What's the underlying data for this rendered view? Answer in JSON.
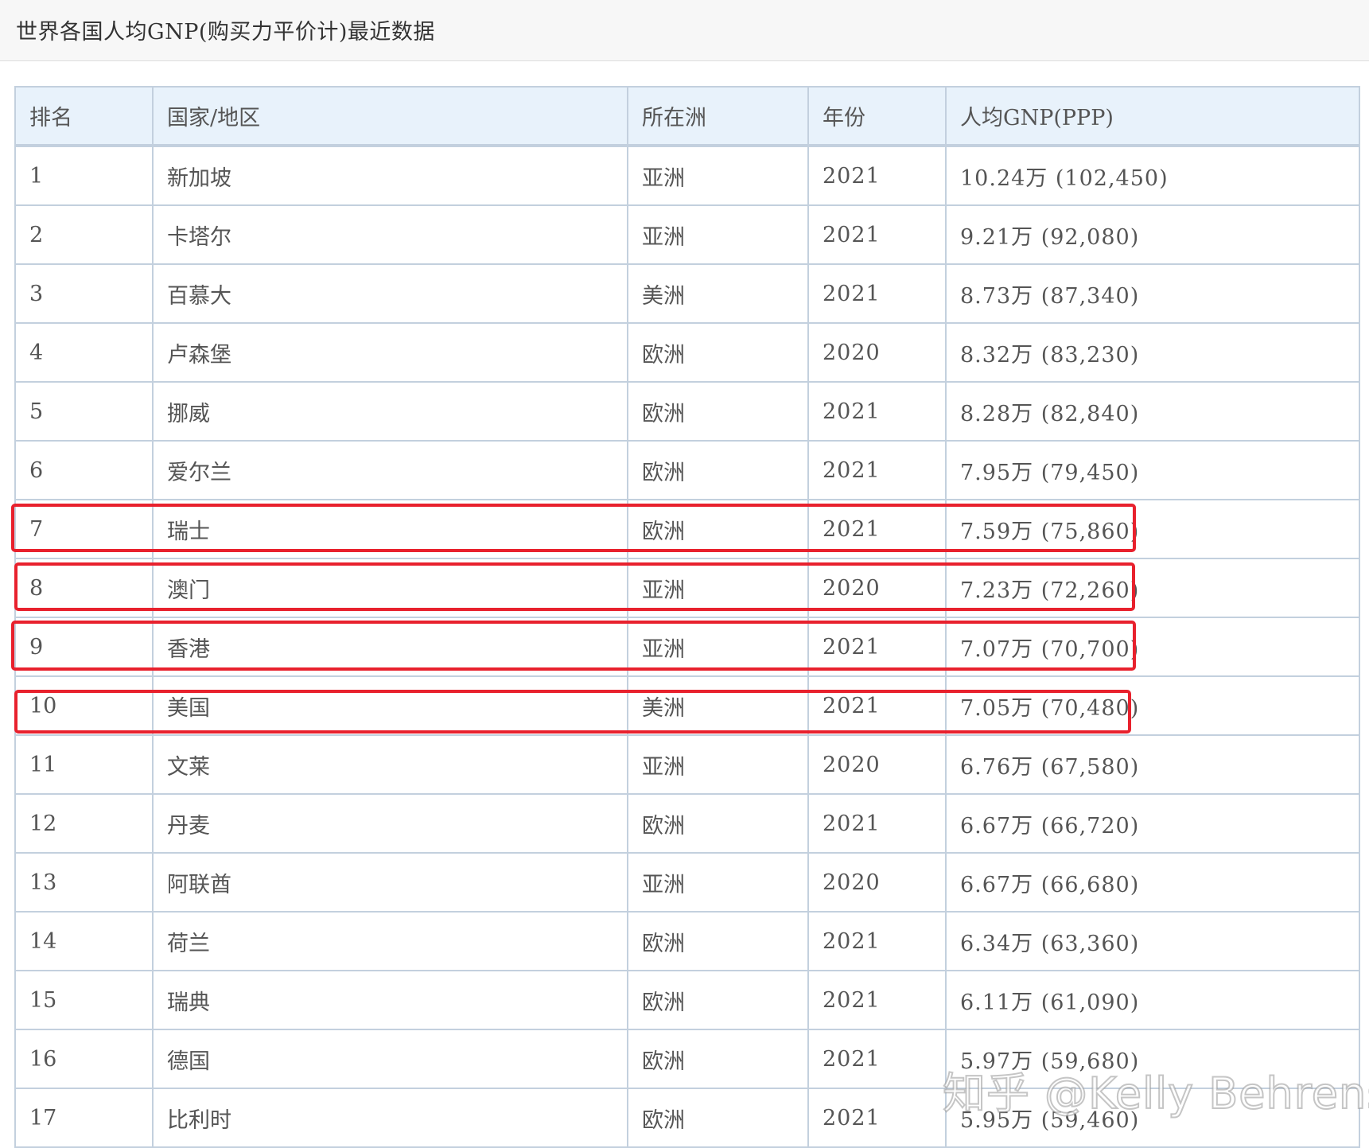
{
  "page": {
    "title": "世界各国人均GNP(购买力平价计)最近数据"
  },
  "table": {
    "headers": [
      "排名",
      "国家/地区",
      "所在洲",
      "年份",
      "人均GNP(PPP)"
    ],
    "rows": [
      {
        "rank": "1",
        "country": "新加坡",
        "continent": "亚洲",
        "year": "2021",
        "value": "10.24万 (102,450)"
      },
      {
        "rank": "2",
        "country": "卡塔尔",
        "continent": "亚洲",
        "year": "2021",
        "value": "9.21万 (92,080)"
      },
      {
        "rank": "3",
        "country": "百慕大",
        "continent": "美洲",
        "year": "2021",
        "value": "8.73万 (87,340)"
      },
      {
        "rank": "4",
        "country": "卢森堡",
        "continent": "欧洲",
        "year": "2020",
        "value": "8.32万 (83,230)"
      },
      {
        "rank": "5",
        "country": "挪威",
        "continent": "欧洲",
        "year": "2021",
        "value": "8.28万 (82,840)"
      },
      {
        "rank": "6",
        "country": "爱尔兰",
        "continent": "欧洲",
        "year": "2021",
        "value": "7.95万 (79,450)"
      },
      {
        "rank": "7",
        "country": "瑞士",
        "continent": "欧洲",
        "year": "2021",
        "value": "7.59万 (75,860)"
      },
      {
        "rank": "8",
        "country": "澳门",
        "continent": "亚洲",
        "year": "2020",
        "value": "7.23万 (72,260)"
      },
      {
        "rank": "9",
        "country": "香港",
        "continent": "亚洲",
        "year": "2021",
        "value": "7.07万 (70,700)"
      },
      {
        "rank": "10",
        "country": "美国",
        "continent": "美洲",
        "year": "2021",
        "value": "7.05万 (70,480)"
      },
      {
        "rank": "11",
        "country": "文莱",
        "continent": "亚洲",
        "year": "2020",
        "value": "6.76万 (67,580)"
      },
      {
        "rank": "12",
        "country": "丹麦",
        "continent": "欧洲",
        "year": "2021",
        "value": "6.67万 (66,720)"
      },
      {
        "rank": "13",
        "country": "阿联酋",
        "continent": "亚洲",
        "year": "2020",
        "value": "6.67万 (66,680)"
      },
      {
        "rank": "14",
        "country": "荷兰",
        "continent": "欧洲",
        "year": "2021",
        "value": "6.34万 (63,360)"
      },
      {
        "rank": "15",
        "country": "瑞典",
        "continent": "欧洲",
        "year": "2021",
        "value": "6.11万 (61,090)"
      },
      {
        "rank": "16",
        "country": "德国",
        "continent": "欧洲",
        "year": "2021",
        "value": "5.97万 (59,680)"
      },
      {
        "rank": "17",
        "country": "比利时",
        "continent": "欧洲",
        "year": "2021",
        "value": "5.95万 (59,460)"
      }
    ],
    "highlighted_ranks": [
      "7",
      "8",
      "9",
      "10"
    ]
  },
  "watermark": {
    "text": "知乎 @Kelly Behrens"
  },
  "colors": {
    "header_bg": "#e8f2fb",
    "border": "#c3d0de",
    "highlight": "#e8212d"
  }
}
